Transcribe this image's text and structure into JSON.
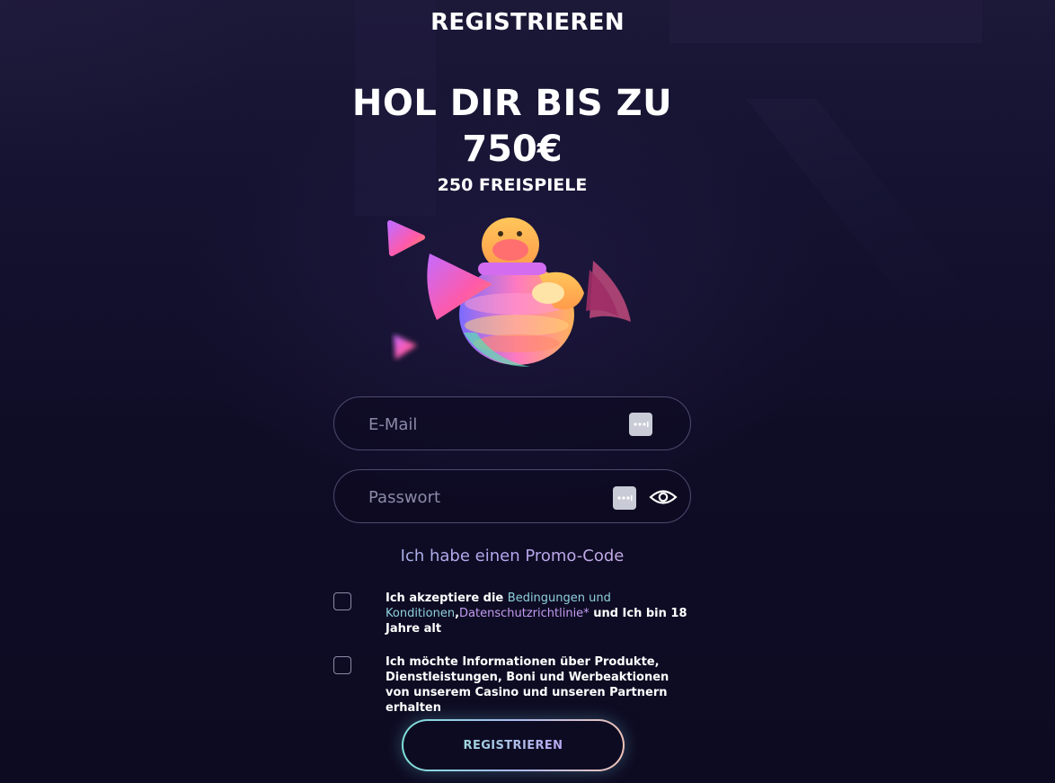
{
  "header": {
    "title": "REGISTRIEREN"
  },
  "hero": {
    "headline": "HOL DIR BIS ZU",
    "amount": "750€",
    "subline": "250 FREISPIELE"
  },
  "form": {
    "email": {
      "placeholder": "E-Mail",
      "value": ""
    },
    "password": {
      "placeholder": "Passwort",
      "value": ""
    },
    "promo_link": "Ich habe einen Promo-Code",
    "terms": {
      "prefix": "Ich akzeptiere die ",
      "link_terms": "Bedingungen und Konditionen",
      "separator": ",",
      "link_privacy": "Datenschutzrichtlinie*",
      "suffix": " und Ich bin 18 Jahre alt",
      "checked": false
    },
    "marketing": {
      "text": "Ich möchte Informationen über Produkte, Dienstleistungen, Boni und Werbeaktionen von unserem Casino und unseren Partnern erhalten",
      "checked": false
    },
    "submit_label": "REGISTRIEREN"
  },
  "icons": {
    "email_field_icon": "password-manager-icon",
    "password_field_icon": "password-manager-icon",
    "password_toggle": "eye-icon"
  },
  "colors": {
    "background": "#0f0d26",
    "field_border": "#4d4a6e",
    "link_teal": "#8fd0dc",
    "link_purple": "#c39cf0",
    "accent_gradient_start": "#7ee0d8",
    "accent_gradient_end": "#f0c4b8"
  }
}
